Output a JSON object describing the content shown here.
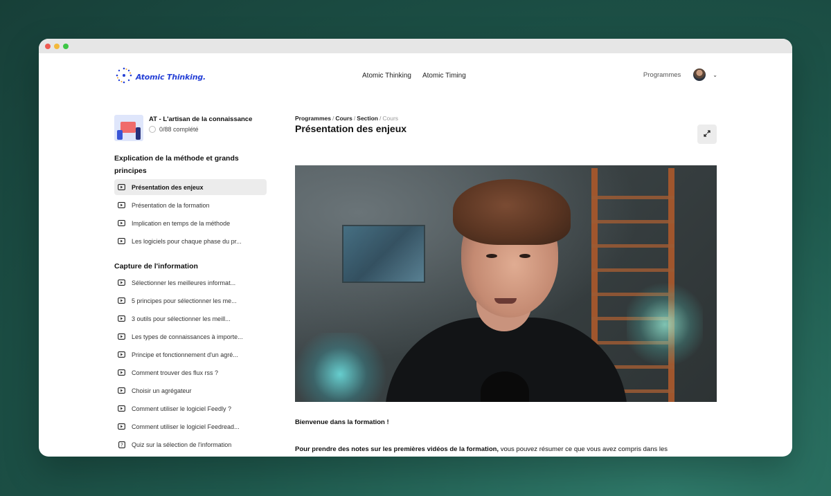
{
  "app": {
    "logo_text": "Atomic Thinking."
  },
  "nav": {
    "links": [
      "Atomic Thinking",
      "Atomic Timing"
    ],
    "programmes_label": "Programmes"
  },
  "course": {
    "title": "AT - L'artisan de la connaissance",
    "progress": "0/88 complété",
    "progress_fraction": 0
  },
  "sidebar": {
    "sections": [
      {
        "title": "Explication de la méthode et grands principes",
        "lessons": [
          {
            "label": "Présentation des enjeux",
            "icon": "play-icon",
            "active": true
          },
          {
            "label": "Présentation de la formation",
            "icon": "play-icon"
          },
          {
            "label": "Implication en temps de la méthode",
            "icon": "play-icon"
          },
          {
            "label": "Les logiciels pour chaque phase du pr...",
            "icon": "play-icon"
          }
        ]
      },
      {
        "title": "Capture de l'information",
        "lessons": [
          {
            "label": "Sélectionner les meilleures informat...",
            "icon": "play-icon"
          },
          {
            "label": "5 principes pour sélectionner les me...",
            "icon": "play-icon"
          },
          {
            "label": "3 outils pour sélectionner les meill...",
            "icon": "play-icon"
          },
          {
            "label": "Les types de connaissances à importe...",
            "icon": "play-icon"
          },
          {
            "label": "Principe et fonctionnement d'un agré...",
            "icon": "play-icon"
          },
          {
            "label": "Comment trouver des flux rss ?",
            "icon": "play-icon"
          },
          {
            "label": "Choisir un agrégateur",
            "icon": "play-icon"
          },
          {
            "label": "Comment utiliser le logiciel Feedly ?",
            "icon": "play-icon"
          },
          {
            "label": "Comment utiliser le logiciel Feedread...",
            "icon": "play-icon"
          },
          {
            "label": "Quiz sur la sélection de l'information",
            "icon": "quiz-icon"
          }
        ]
      }
    ]
  },
  "breadcrumb": {
    "items": [
      "Programmes",
      "Cours",
      "Section",
      "Cours"
    ],
    "separator": "/"
  },
  "main": {
    "title": "Présentation des enjeux",
    "intro": "Bienvenue dans la formation !",
    "para_bold": "Pour prendre des notes sur les premières vidéos de la formation,",
    "para_rest": " vous pouvez résumer ce que vous avez compris dans les"
  },
  "colors": {
    "brand": "#2540d6",
    "active_bg": "#ececec"
  }
}
